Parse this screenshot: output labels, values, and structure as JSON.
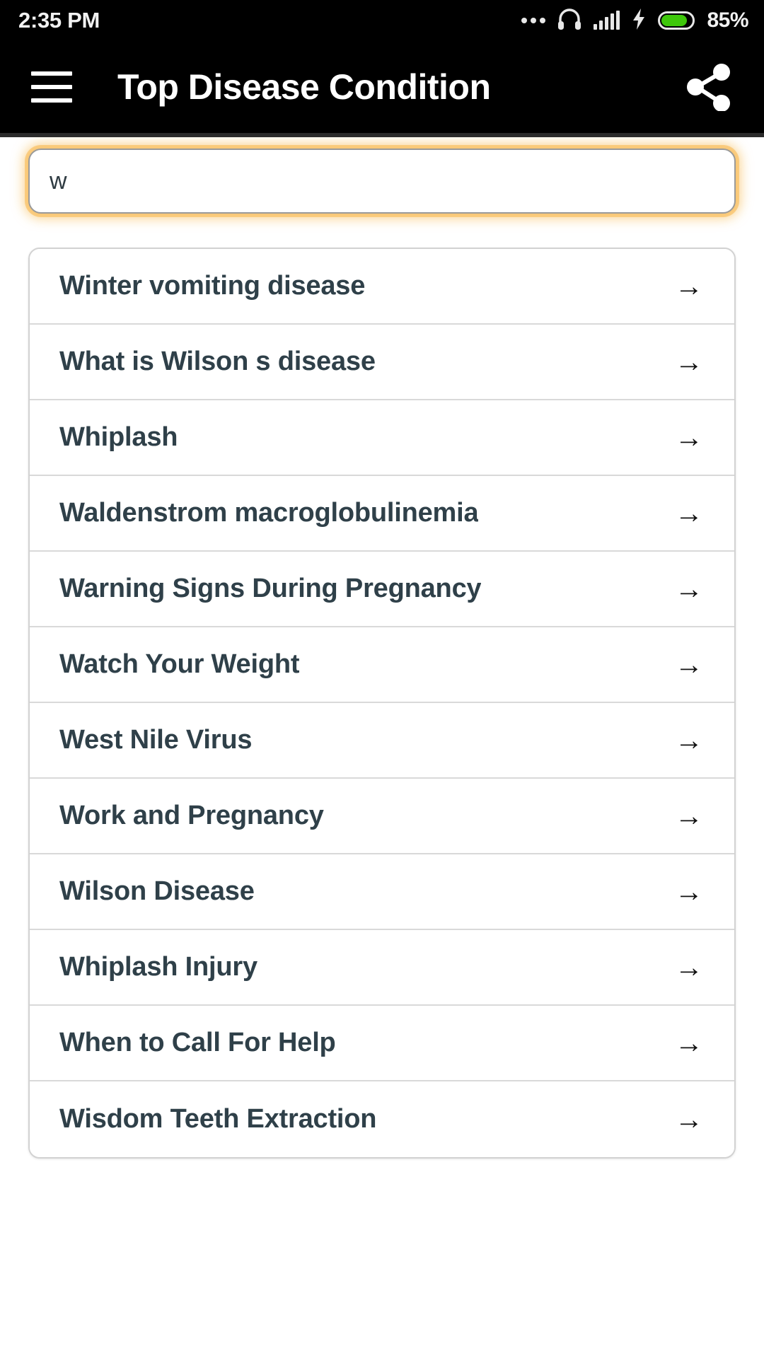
{
  "status_bar": {
    "time": "2:35 PM",
    "battery_percent": "85%",
    "battery_level": 85,
    "icons": [
      "more-dots-icon",
      "headphones-icon",
      "signal-bars-icon",
      "charging-bolt-icon",
      "battery-icon"
    ],
    "battery_color": "#3ec70b",
    "text_color": "#f2f2f2",
    "background": "#000000"
  },
  "app_bar": {
    "title": "Top Disease Condition",
    "menu_icon": "hamburger-menu-icon",
    "share_icon": "share-icon",
    "background": "#000000",
    "title_color": "#ffffff"
  },
  "search": {
    "value": "w",
    "placeholder": "",
    "focus_glow_color": "#f7b74b",
    "border_color": "#9a9a9a"
  },
  "list": {
    "arrow_glyph": "→",
    "row_text_color": "#2f4049",
    "items": [
      {
        "label": "Winter vomiting disease"
      },
      {
        "label": "What is Wilson s disease"
      },
      {
        "label": "Whiplash"
      },
      {
        "label": "Waldenstrom macroglobulinemia"
      },
      {
        "label": "Warning Signs During Pregnancy"
      },
      {
        "label": "Watch Your Weight"
      },
      {
        "label": "West Nile Virus"
      },
      {
        "label": "Work and Pregnancy"
      },
      {
        "label": "Wilson Disease"
      },
      {
        "label": "Whiplash Injury"
      },
      {
        "label": "When to Call For Help"
      },
      {
        "label": "Wisdom Teeth Extraction"
      }
    ]
  }
}
